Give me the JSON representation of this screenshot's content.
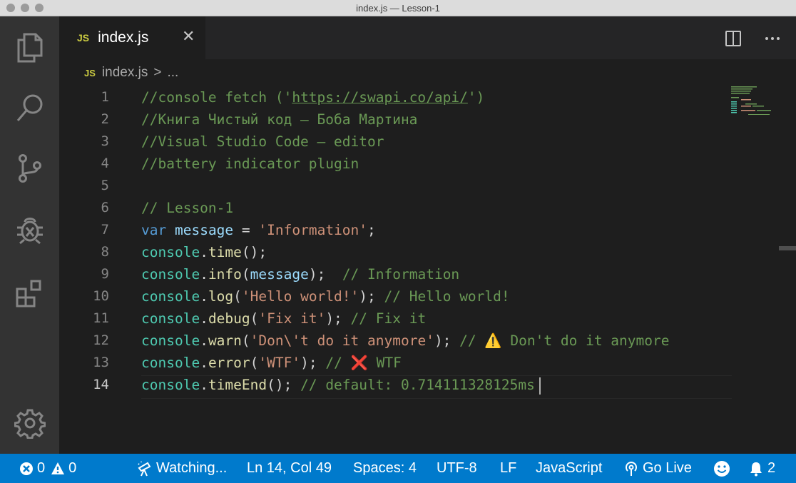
{
  "window": {
    "title": "index.js — Lesson-1"
  },
  "activity_bar": {
    "items": [
      {
        "icon": "files-icon"
      },
      {
        "icon": "search-icon"
      },
      {
        "icon": "source-control-icon"
      },
      {
        "icon": "debug-icon"
      },
      {
        "icon": "extensions-icon"
      }
    ],
    "settings_icon": "gear-icon"
  },
  "tab": {
    "badge": "JS",
    "label": "index.js",
    "close": "✕"
  },
  "editor_actions": {
    "split_icon": "split-editor-icon",
    "more_icon": "more-icon"
  },
  "breadcrumb": {
    "badge": "JS",
    "file": "index.js",
    "separator": ">",
    "more": "..."
  },
  "editor": {
    "active_line": 14,
    "lines": [
      {
        "n": "1"
      },
      {
        "n": "2"
      },
      {
        "n": "3"
      },
      {
        "n": "4"
      },
      {
        "n": "5"
      },
      {
        "n": "6"
      },
      {
        "n": "7"
      },
      {
        "n": "8"
      },
      {
        "n": "9"
      },
      {
        "n": "10"
      },
      {
        "n": "11"
      },
      {
        "n": "12"
      },
      {
        "n": "13"
      },
      {
        "n": "14"
      }
    ],
    "code": {
      "l1a": "//console fetch ('",
      "l1b": "https://swapi.co/api/",
      "l1c": "')",
      "l2": "//Книга Чистый код – Боба Мартина",
      "l3": "//Visual Studio Code – editor",
      "l4": "//battery indicator plugin",
      "l6": "// Lesson-1",
      "l7_kw": "var",
      "l7_var": "message",
      "l7_eq": " = ",
      "l7_str": "'Information'",
      "l7_end": ";",
      "console": "console",
      "dot": ".",
      "l8_fn": "time",
      "l8_end": "();",
      "l9_fn": "info",
      "l9_open": "(",
      "l9_arg": "message",
      "l9_close": ");  ",
      "l9_cmt": "// Information",
      "l10_fn": "log",
      "l10_open": "(",
      "l10_str": "'Hello world!'",
      "l10_close": "); ",
      "l10_cmt": "// Hello world!",
      "l11_fn": "debug",
      "l11_open": "(",
      "l11_str": "'Fix it'",
      "l11_close": "); ",
      "l11_cmt": "// Fix it",
      "l12_fn": "warn",
      "l12_open": "(",
      "l12_str": "'Don\\'t do it anymore'",
      "l12_close": "); ",
      "l12_cmt_a": "// ",
      "l12_emoji": "⚠️",
      "l12_cmt_b": " Don't do it anymore",
      "l13_fn": "error",
      "l13_open": "(",
      "l13_str": "'WTF'",
      "l13_close": "); ",
      "l13_cmt_a": "// ",
      "l13_emoji": "❌",
      "l13_cmt_b": " WTF",
      "l14_fn": "timeEnd",
      "l14_end": "(); ",
      "l14_cmt": "// default: 0.714111328125ms"
    }
  },
  "status_bar": {
    "errors": "0",
    "warnings": "0",
    "watching": "Watching...",
    "position": "Ln 14, Col 49",
    "spaces": "Spaces: 4",
    "encoding": "UTF-8",
    "eol": "LF",
    "language": "JavaScript",
    "golive": "Go Live",
    "notifications": "2",
    "colors": {
      "background": "#007acc",
      "text": "#ffffff"
    }
  }
}
